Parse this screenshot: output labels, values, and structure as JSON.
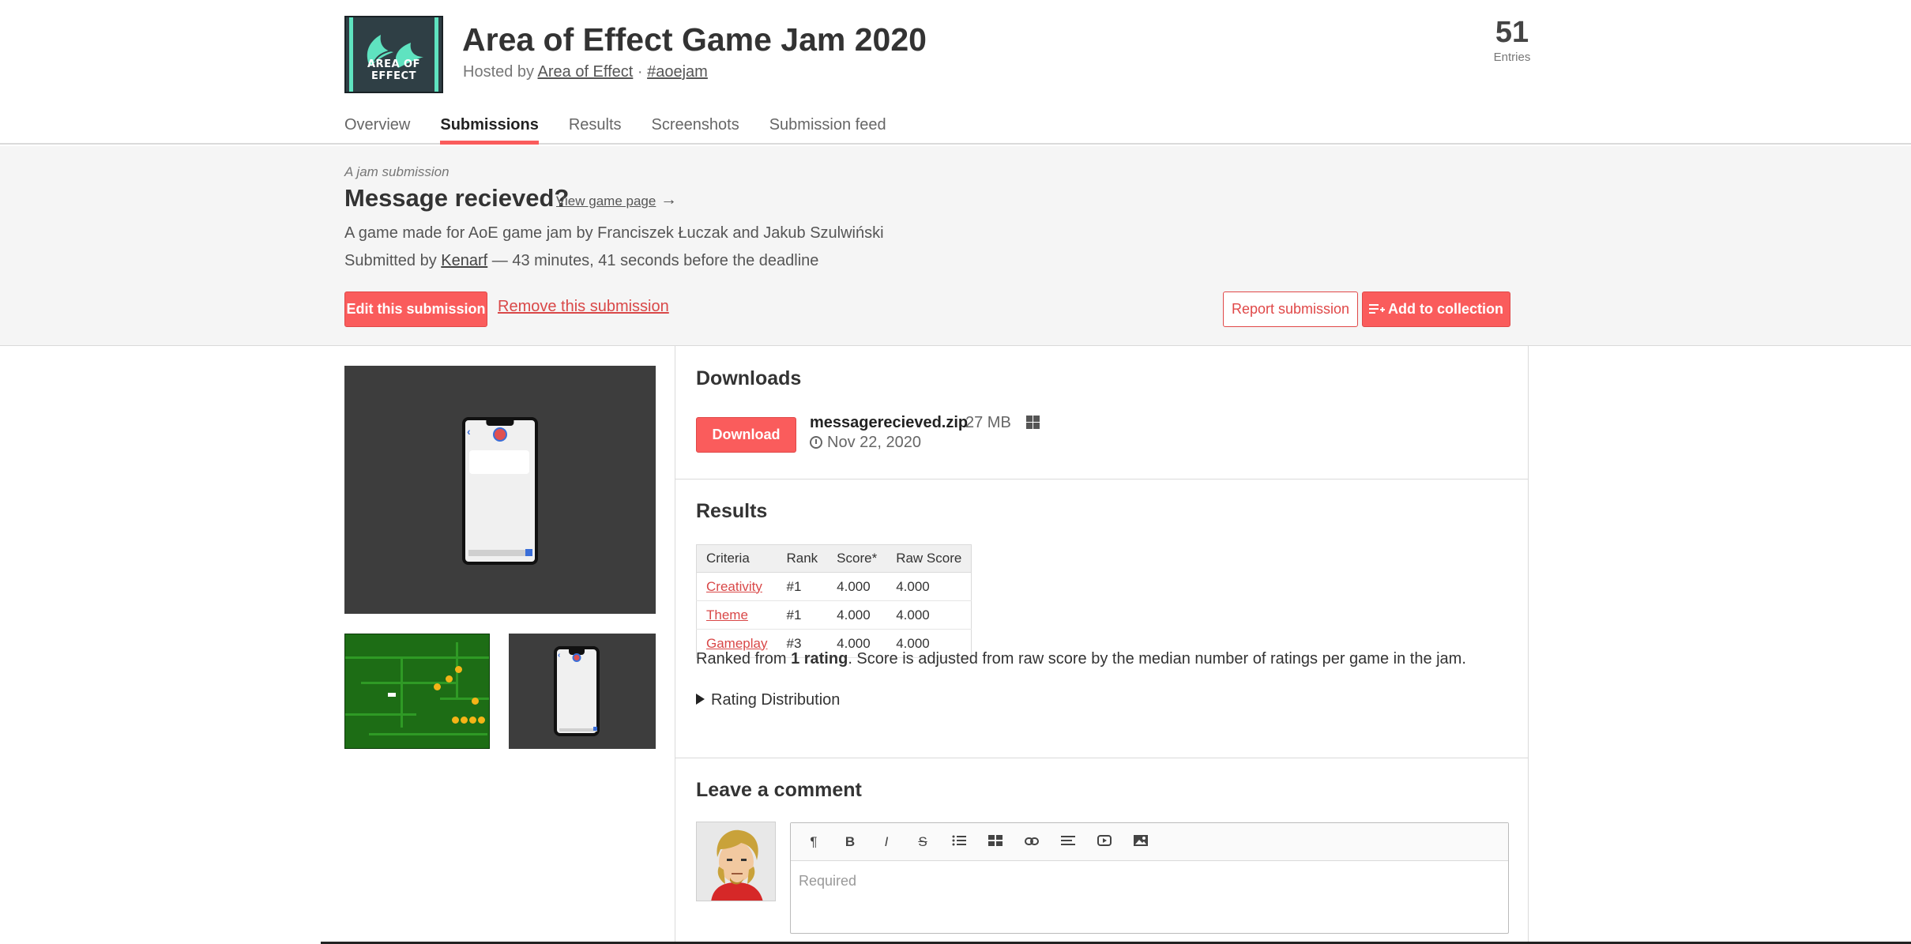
{
  "jam": {
    "logo_text": "AREA OF EFFECT",
    "title": "Area of Effect Game Jam 2020",
    "hosted_prefix": "Hosted by",
    "host": "Area of Effect",
    "separator": "·",
    "hashtag": "#aoejam",
    "entries_count": "51",
    "entries_label": "Entries",
    "tabs": [
      "Overview",
      "Submissions",
      "Results",
      "Screenshots",
      "Submission feed"
    ],
    "active_tab": "Submissions"
  },
  "submission": {
    "kicker": "A jam submission",
    "title": "Message recieved?",
    "view_link": "View game page",
    "view_arrow": "→",
    "description": "A game made for AoE game jam by Franciszek Łuczak and Jakub Szulwiński",
    "submitted_prefix": "Submitted by",
    "submitter": "Kenarf",
    "submitted_suffix": "— 43 minutes, 41 seconds before the deadline",
    "edit_label": "Edit this submission",
    "remove_label": "Remove this submission",
    "report_label": "Report submission",
    "collection_label": "Add to collection"
  },
  "downloads": {
    "title": "Downloads",
    "button_label": "Download",
    "file_name": "messagerecieved.zip",
    "file_size": "27 MB",
    "platform_icon": "windows-icon",
    "date": "Nov 22, 2020"
  },
  "results": {
    "title": "Results",
    "headers": [
      "Criteria",
      "Rank",
      "Score*",
      "Raw Score"
    ],
    "rows": [
      {
        "criteria": "Creativity",
        "rank": "#1",
        "score": "4.000",
        "raw": "4.000"
      },
      {
        "criteria": "Theme",
        "rank": "#1",
        "score": "4.000",
        "raw": "4.000"
      },
      {
        "criteria": "Gameplay",
        "rank": "#3",
        "score": "4.000",
        "raw": "4.000"
      }
    ],
    "note_prefix": "Ranked from",
    "note_bold": "1 rating",
    "note_suffix": ". Score is adjusted from raw score by the median number of ratings per game in the jam.",
    "distribution_label": "Rating Distribution"
  },
  "comment": {
    "title": "Leave a comment",
    "placeholder": "Required",
    "toolbar": [
      "¶",
      "B",
      "I",
      "S",
      "list-icon",
      "table-icon",
      "link-icon",
      "align-icon",
      "video-icon",
      "image-icon"
    ]
  },
  "colors": {
    "accent": "#fa5c5c",
    "link_red": "#d94848",
    "screenshot_bg": "#3d3d3d",
    "game_green": "#1d6d15"
  }
}
